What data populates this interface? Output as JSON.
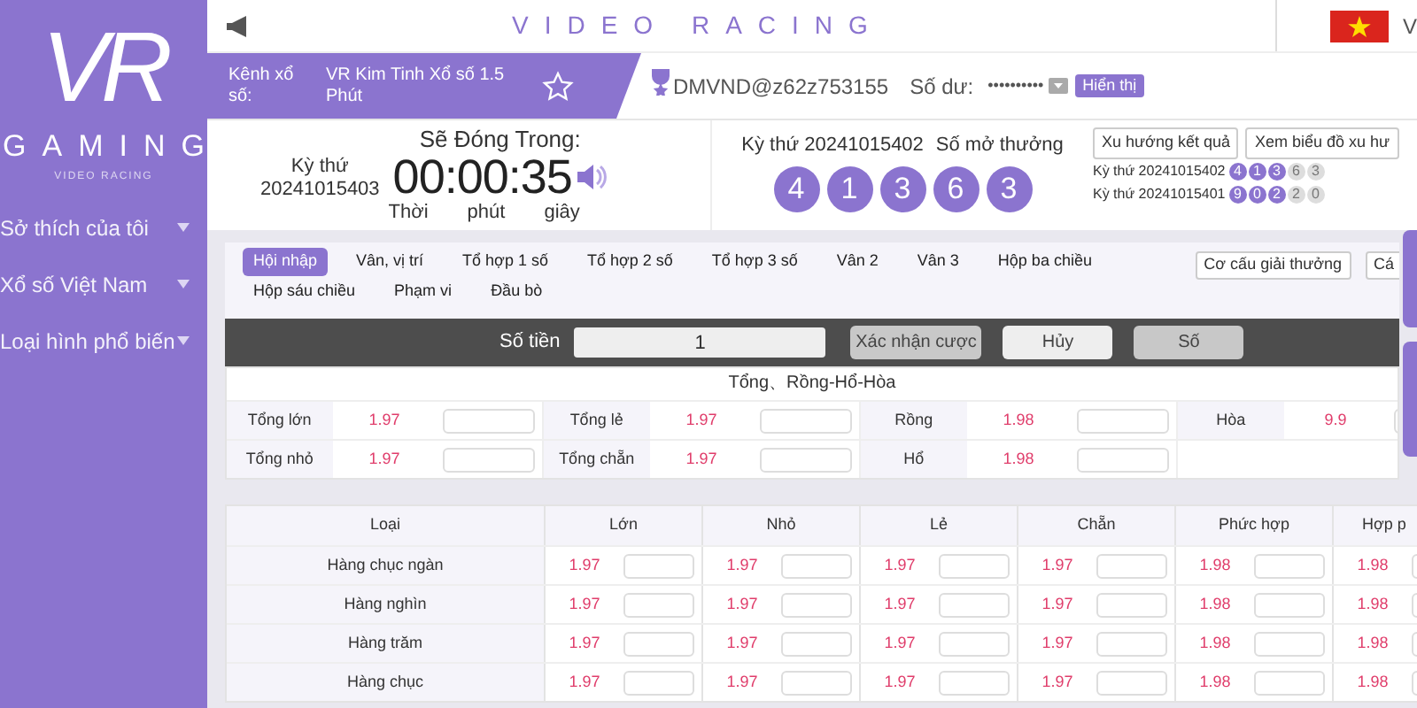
{
  "sidebar": {
    "logo": {
      "mark": "VR",
      "title": "GAMING",
      "subtitle": "VIDEO RACING"
    },
    "items": [
      {
        "label": "Sở thích của tôi"
      },
      {
        "label": "Xổ số Việt Nam"
      },
      {
        "label": "Loại hình phổ biến"
      }
    ]
  },
  "header": {
    "title": "VIDEO RACING",
    "language": "V"
  },
  "channel": {
    "label": "Kênh xổ số:",
    "name": "VR Kim Tinh Xổ số 1.5 Phút",
    "favorite": false
  },
  "account": {
    "user": "DMVND@z62z753155",
    "balance_label": "Số dư:",
    "balance": "••••••••••",
    "show_button": "Hiển thị"
  },
  "countdown": {
    "period_label": "Kỳ thứ",
    "period": "20241015403",
    "title": "Sẽ Đóng Trong:",
    "time": "00:00:35",
    "units": [
      "Thời",
      "phút",
      "giây"
    ]
  },
  "last_result": {
    "period": "Kỳ thứ 20241015402",
    "label": "Số mở thưởng",
    "balls": [
      "4",
      "1",
      "3",
      "6",
      "3"
    ]
  },
  "trend_buttons": [
    "Xu hướng kết quả",
    "Xem biểu đồ xu hư"
  ],
  "history": [
    {
      "period": "Kỳ thứ 20241015402",
      "balls": [
        {
          "value": "4",
          "highlighted": true
        },
        {
          "value": "1",
          "highlighted": true
        },
        {
          "value": "3",
          "highlighted": true
        },
        {
          "value": "6",
          "highlighted": false
        },
        {
          "value": "3",
          "highlighted": false
        }
      ]
    },
    {
      "period": "Kỳ thứ 20241015401",
      "balls": [
        {
          "value": "9",
          "highlighted": true
        },
        {
          "value": "0",
          "highlighted": true
        },
        {
          "value": "2",
          "highlighted": true
        },
        {
          "value": "2",
          "highlighted": false
        },
        {
          "value": "0",
          "highlighted": false
        }
      ]
    }
  ],
  "tabs": [
    {
      "label": "Hội nhập",
      "selected": true
    },
    {
      "label": "Vân, vị trí",
      "selected": false
    },
    {
      "label": "Tổ hợp 1 số",
      "selected": false
    },
    {
      "label": "Tổ hợp 2 số",
      "selected": false
    },
    {
      "label": "Tổ hợp 3 số",
      "selected": false
    },
    {
      "label": "Vân 2",
      "selected": false
    },
    {
      "label": "Vân 3",
      "selected": false
    },
    {
      "label": "Hộp ba chiều",
      "selected": false
    },
    {
      "label": "Hộp sáu chiều",
      "selected": false
    },
    {
      "label": "Phạm vi",
      "selected": false
    },
    {
      "label": "Đầu bò",
      "selected": false
    }
  ],
  "tab_buttons": [
    "Cơ cấu giải thưởng",
    "Cá"
  ],
  "bet_bar": {
    "amount_label": "Số tiền",
    "amount": "1",
    "buttons": [
      "Xác nhận cược",
      "Hủy",
      "Số"
    ]
  },
  "odds_table": {
    "title": "Tổng、Rồng-Hổ-Hòa",
    "rows": [
      [
        {
          "label": "Tổng lớn",
          "odds": "1.97"
        },
        {
          "label": "Tổng lẻ",
          "odds": "1.97"
        },
        {
          "label": "Rồng",
          "odds": "1.98"
        },
        {
          "label": "Hòa",
          "odds": "9.9"
        }
      ],
      [
        {
          "label": "Tổng nhỏ",
          "odds": "1.97"
        },
        {
          "label": "Tổng chẵn",
          "odds": "1.97"
        },
        {
          "label": "Hổ",
          "odds": "1.98"
        }
      ]
    ]
  },
  "bet_table": {
    "columns": [
      "Loại",
      "Lớn",
      "Nhỏ",
      "Lẻ",
      "Chẵn",
      "Phức hợp",
      "Hợp p"
    ],
    "rows": [
      {
        "label": "Hàng chục ngàn",
        "odds": [
          "1.97",
          "1.97",
          "1.97",
          "1.97",
          "1.98",
          "1.98"
        ]
      },
      {
        "label": "Hàng nghìn",
        "odds": [
          "1.97",
          "1.97",
          "1.97",
          "1.97",
          "1.98",
          "1.98"
        ]
      },
      {
        "label": "Hàng trăm",
        "odds": [
          "1.97",
          "1.97",
          "1.97",
          "1.97",
          "1.98",
          "1.98"
        ]
      },
      {
        "label": "Hàng chục",
        "odds": [
          "1.97",
          "1.97",
          "1.97",
          "1.97",
          "1.98",
          "1.98"
        ]
      }
    ]
  }
}
